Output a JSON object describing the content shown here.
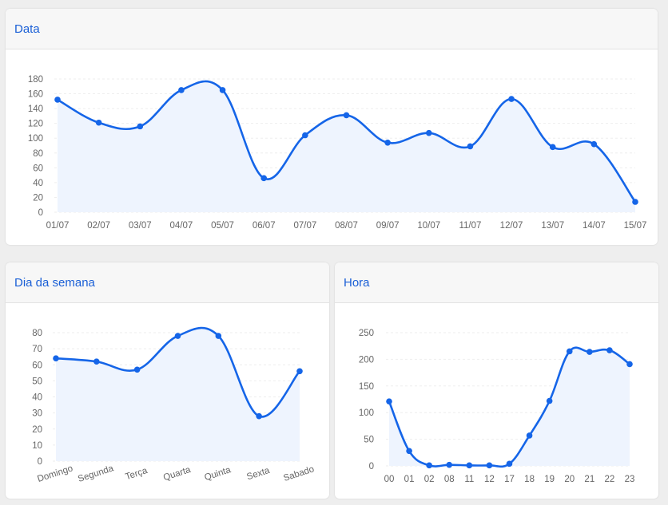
{
  "chart_data": [
    {
      "type": "line",
      "title": "Data",
      "categories": [
        "01/07",
        "02/07",
        "03/07",
        "04/07",
        "05/07",
        "06/07",
        "07/07",
        "08/07",
        "09/07",
        "10/07",
        "11/07",
        "12/07",
        "13/07",
        "14/07",
        "15/07"
      ],
      "series": [
        {
          "values": [
            152,
            121,
            116,
            165,
            165,
            46,
            104,
            131,
            94,
            107,
            89,
            153,
            88,
            92,
            14
          ]
        }
      ],
      "ylim": [
        0,
        180
      ],
      "yticks": [
        0,
        20,
        40,
        60,
        80,
        100,
        120,
        140,
        160,
        180
      ],
      "grid": true,
      "color": "#1565e8"
    },
    {
      "type": "line",
      "title": "Dia da semana",
      "categories": [
        "Domingo",
        "Segunda",
        "Terça",
        "Quarta",
        "Quinta",
        "Sexta",
        "Sabado"
      ],
      "series": [
        {
          "values": [
            64,
            62,
            57,
            78,
            78,
            28,
            56
          ]
        }
      ],
      "ylim": [
        0,
        80
      ],
      "yticks": [
        0,
        10,
        20,
        30,
        40,
        50,
        60,
        70,
        80
      ],
      "grid": true,
      "color": "#1565e8"
    },
    {
      "type": "line",
      "title": "Hora",
      "categories": [
        "00",
        "01",
        "02",
        "08",
        "11",
        "12",
        "17",
        "18",
        "19",
        "20",
        "21",
        "22",
        "23"
      ],
      "series": [
        {
          "values": [
            121,
            28,
            1,
            2,
            1,
            1,
            4,
            57,
            122,
            215,
            214,
            217,
            191
          ]
        }
      ],
      "ylim": [
        0,
        250
      ],
      "yticks": [
        0,
        50,
        100,
        150,
        200,
        250
      ],
      "grid": true,
      "color": "#1565e8"
    }
  ]
}
